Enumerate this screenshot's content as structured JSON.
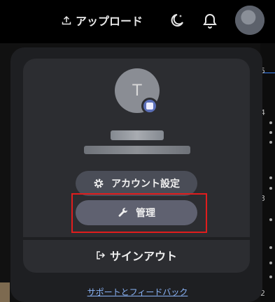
{
  "topbar": {
    "upload_label": "アップロード"
  },
  "profile": {
    "avatar_initial": "T"
  },
  "menu": {
    "account_settings_label": "アカウント設定",
    "admin_label": "管理",
    "signout_label": "サインアウト",
    "feedback_label": "サポートとフィードバック"
  },
  "sidebar_numbers": [
    "5",
    "4",
    "3",
    "2"
  ],
  "colors": {
    "panel": "#1e1f22",
    "card": "#2c2d31",
    "pill": "#4a4d57",
    "link": "#8ab4f8",
    "highlight": "#e11d1d"
  }
}
